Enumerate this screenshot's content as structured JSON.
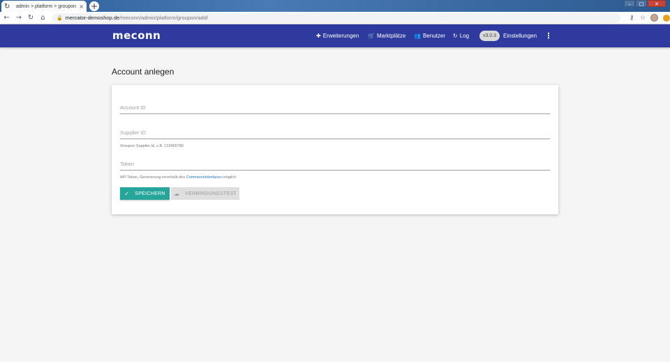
{
  "browser": {
    "tab_title": "admin > platform > groupon",
    "tab_favicon": "↻",
    "tab_close": "×",
    "new_tab": "+",
    "url_host": "mercator-demoshop.de",
    "url_path": "/meconn/admin/platform/groupon/add/",
    "window_controls": [
      "–",
      "□",
      "✕"
    ],
    "nav_icons": {
      "back": "←",
      "forward": "→",
      "reload": "↻",
      "home": "⌂"
    },
    "right_icons": {
      "key": "⚷",
      "star": "☆"
    }
  },
  "app": {
    "logo": "meconn",
    "nav": [
      {
        "label": "Erweiterungen",
        "icon": "✚"
      },
      {
        "label": "Marktplätze",
        "icon": "🛒"
      },
      {
        "label": "Benutzer",
        "icon": "👥"
      },
      {
        "label": "Log",
        "icon": "↻"
      }
    ],
    "version": "v3.0.3",
    "settings_label": "Einstellungen",
    "menu_icon": "⋮"
  },
  "page": {
    "title": "Account anlegen",
    "form": {
      "account_id_label": "Account ID",
      "supplier_id_label": "Supplier ID",
      "supplier_hint": "Groupon Supplier Id, z.B. 123456789",
      "token_label": "Token",
      "token_hint_prefix": "API Token, Generierung innerhalb des ",
      "token_hint_link": "CommerceInterfaces",
      "token_hint_suffix": " möglich",
      "save_label": "SPEICHERN",
      "save_icon": "✓",
      "test_label": "VERBINDUNGSTEST",
      "test_icon": "☁"
    }
  },
  "colors": {
    "appbar": "#2e3a9e",
    "primary_button": "#26a69a",
    "background": "#f5f5f5"
  }
}
